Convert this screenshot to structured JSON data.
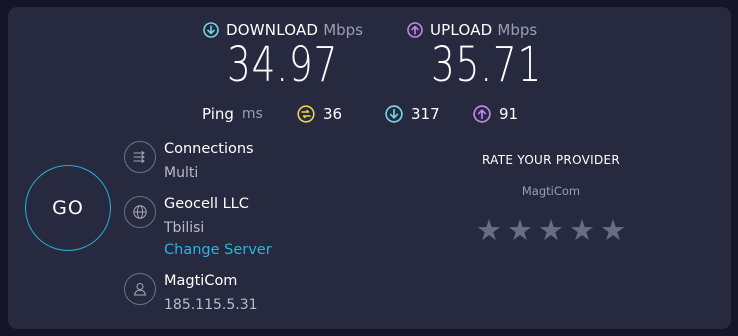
{
  "download": {
    "label": "DOWNLOAD",
    "unit": "Mbps",
    "value": "34.97",
    "color": "#6fd7e4"
  },
  "upload": {
    "label": "UPLOAD",
    "unit": "Mbps",
    "value": "35.71",
    "color": "#c186ea"
  },
  "ping": {
    "label": "Ping",
    "unit": "ms",
    "idle": "36",
    "download": "317",
    "upload": "91",
    "idle_color": "#f2d24b"
  },
  "go_button": {
    "label": "GO",
    "color": "#27b2d3"
  },
  "connections": {
    "title": "Connections",
    "value": "Multi",
    "icon": "connections-icon"
  },
  "server": {
    "title": "Geocell LLC",
    "location": "Tbilisi",
    "change_label": "Change Server",
    "icon": "globe-icon"
  },
  "provider": {
    "title": "MagtiCom",
    "ip": "185.115.5.31",
    "icon": "user-icon"
  },
  "rating": {
    "title": "RATE YOUR PROVIDER",
    "provider": "MagtiCom",
    "stars": 0,
    "max_stars": 5
  },
  "colors": {
    "background": "#141526",
    "panel": "#272a3f",
    "link": "#28b3e4"
  }
}
